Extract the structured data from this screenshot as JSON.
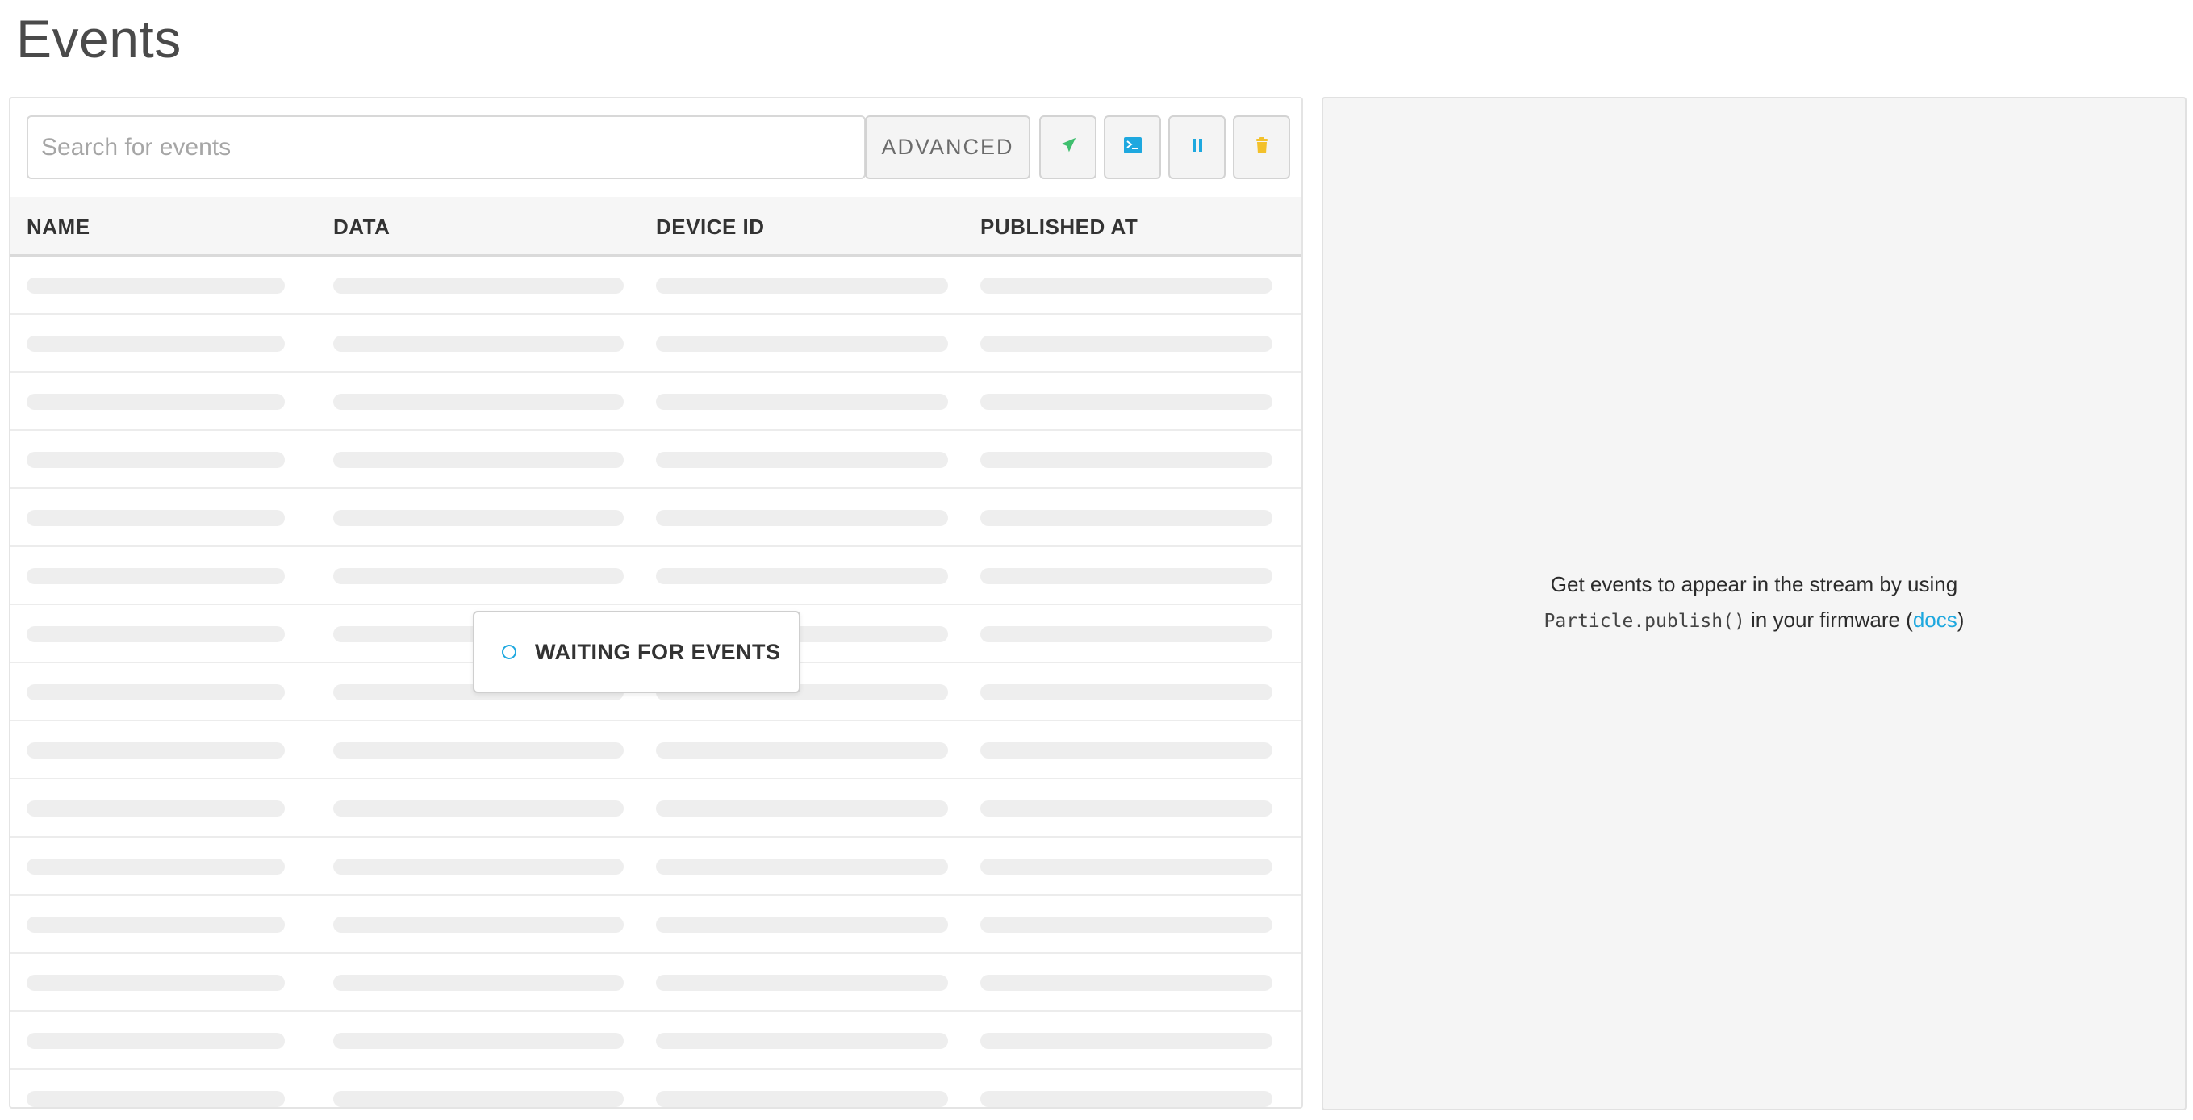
{
  "page": {
    "title": "Events"
  },
  "toolbar": {
    "search_placeholder": "Search for events",
    "advanced_label": "ADVANCED",
    "icons": {
      "send": "paper-plane-icon",
      "terminal": "terminal-icon",
      "pause": "pause-icon",
      "delete": "trash-icon"
    },
    "icon_colors": {
      "send": "#3fbf6e",
      "terminal": "#1ea8df",
      "pause": "#1ea8df",
      "delete": "#f3c12b"
    }
  },
  "table": {
    "columns": [
      {
        "label": "NAME"
      },
      {
        "label": "DATA"
      },
      {
        "label": "DEVICE ID"
      },
      {
        "label": "PUBLISHED AT"
      }
    ],
    "placeholder_row_count": 15
  },
  "status": {
    "waiting_label": "WAITING FOR EVENTS"
  },
  "info": {
    "line1": "Get events to appear in the stream by using",
    "code": "Particle.publish()",
    "middle": " in your firmware (",
    "link_label": "docs",
    "end": ")"
  },
  "colors": {
    "accent": "#1ea8df",
    "skeleton": "#eeeeee",
    "panel_bg": "#f5f5f5"
  }
}
